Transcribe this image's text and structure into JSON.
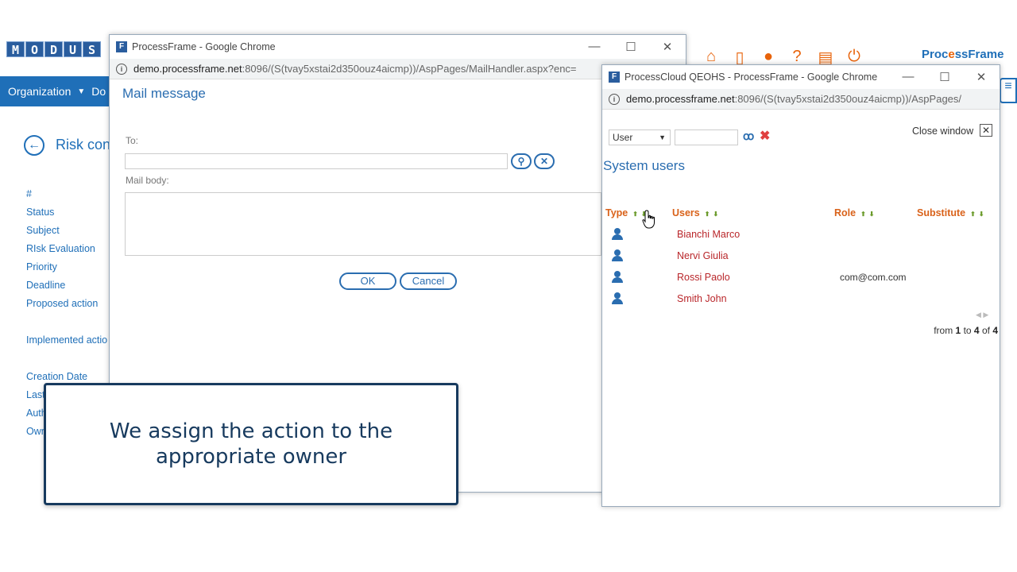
{
  "background": {
    "logo_letters": [
      "M",
      "O",
      "D",
      "U",
      "S"
    ],
    "nav": {
      "organization": "Organization",
      "next_partial": "Do"
    },
    "brand": {
      "part1": "Proc",
      "part2": "e",
      "part3": "ssFrame"
    },
    "top_icons": [
      "home-icon",
      "mobile-icon",
      "user-icon",
      "help-icon",
      "document-icon",
      "power-icon"
    ],
    "page_title": "Risk con",
    "fields": [
      "#",
      "Status",
      "Subject",
      "RIsk Evaluation",
      "Priority",
      "Deadline",
      "Proposed action",
      "",
      "Implemented actio",
      "",
      "Creation Date",
      "Last",
      "Auth",
      "Own"
    ]
  },
  "mail_window": {
    "title": "ProcessFrame - Google Chrome",
    "url_host": "demo.processframe.net",
    "url_path": ":8096/(S(tvay5xstai2d350ouz4aicmp))/AspPages/MailHandler.aspx?enc=",
    "heading": "Mail message",
    "to_label": "To:",
    "body_label": "Mail body:",
    "ok_label": "OK",
    "cancel_label": "Cancel"
  },
  "users_window": {
    "title": "ProcessCloud QEOHS - ProcessFrame - Google Chrome",
    "url_host": "demo.processframe.net",
    "url_path": ":8096/(S(tvay5xstai2d350ouz4aicmp))/AspPages/",
    "filter_select": "User",
    "close_label": "Close window",
    "heading": "System users",
    "columns": {
      "type": "Type",
      "users": "Users",
      "role": "Role",
      "substitute": "Substitute"
    },
    "rows": [
      {
        "name": "Bianchi Marco",
        "role": ""
      },
      {
        "name": "Nervi Giulia",
        "role": ""
      },
      {
        "name": "Rossi Paolo",
        "role": "com@com.com"
      },
      {
        "name": "Smith John",
        "role": ""
      }
    ],
    "pager": {
      "from_word": "from",
      "start": "1",
      "to_word": "to",
      "end": "4",
      "of_word": "of",
      "total": "4"
    }
  },
  "caption": "We assign the action to the appropriate owner"
}
